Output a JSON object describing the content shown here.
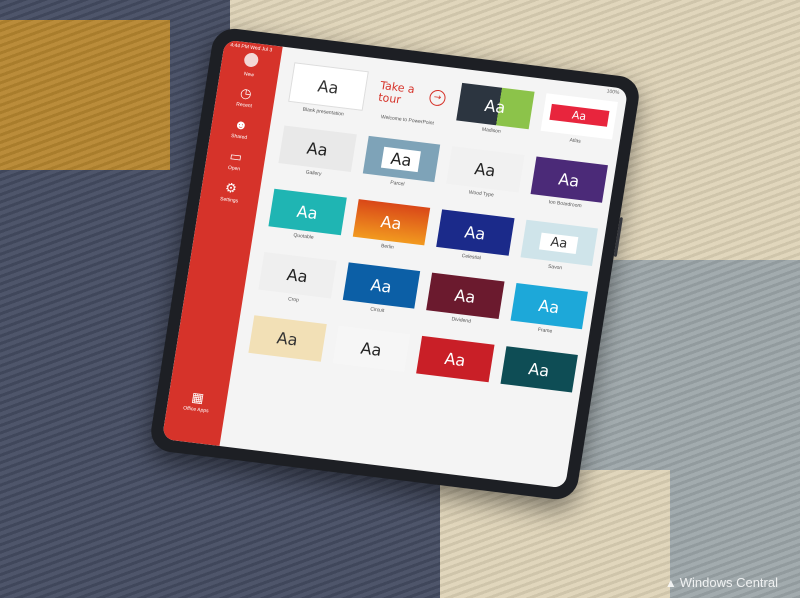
{
  "status": {
    "time": "4:44 PM",
    "date": "Wed Jul 3",
    "battery": "100%"
  },
  "sidebar": {
    "items": [
      {
        "icon": "home-icon",
        "label": "New"
      },
      {
        "icon": "recent-icon",
        "label": "Recent"
      },
      {
        "icon": "shared-icon",
        "label": "Shared"
      },
      {
        "icon": "open-folder-icon",
        "label": "Open"
      },
      {
        "icon": "settings-icon",
        "label": "Settings"
      },
      {
        "icon": "office-apps-icon",
        "label": "Office Apps"
      }
    ]
  },
  "templates": [
    {
      "name": "Blank presentation",
      "thumb": "Aa"
    },
    {
      "name": "Welcome to PowerPoint",
      "thumb": "Take a tour"
    },
    {
      "name": "Madison",
      "thumb": "Aa"
    },
    {
      "name": "Atlas",
      "thumb": "Aa"
    },
    {
      "name": "Gallery",
      "thumb": "Aa"
    },
    {
      "name": "Parcel",
      "thumb": "Aa"
    },
    {
      "name": "Wood Type",
      "thumb": "Aa"
    },
    {
      "name": "Ion Boardroom",
      "thumb": "Aa"
    },
    {
      "name": "Quotable",
      "thumb": "Aa"
    },
    {
      "name": "Berlin",
      "thumb": "Aa"
    },
    {
      "name": "Celestial",
      "thumb": "Aa"
    },
    {
      "name": "Savon",
      "thumb": "Aa"
    },
    {
      "name": "Crop",
      "thumb": "Aa"
    },
    {
      "name": "Circuit",
      "thumb": "Aa"
    },
    {
      "name": "Dividend",
      "thumb": "Aa"
    },
    {
      "name": "Frame",
      "thumb": "Aa"
    },
    {
      "name": "",
      "thumb": "Aa"
    },
    {
      "name": "",
      "thumb": "Aa"
    },
    {
      "name": "",
      "thumb": "Aa"
    },
    {
      "name": "",
      "thumb": "Aa"
    }
  ],
  "watermark": {
    "text": "Windows Central"
  },
  "colors": {
    "accent": "#d6332a"
  }
}
